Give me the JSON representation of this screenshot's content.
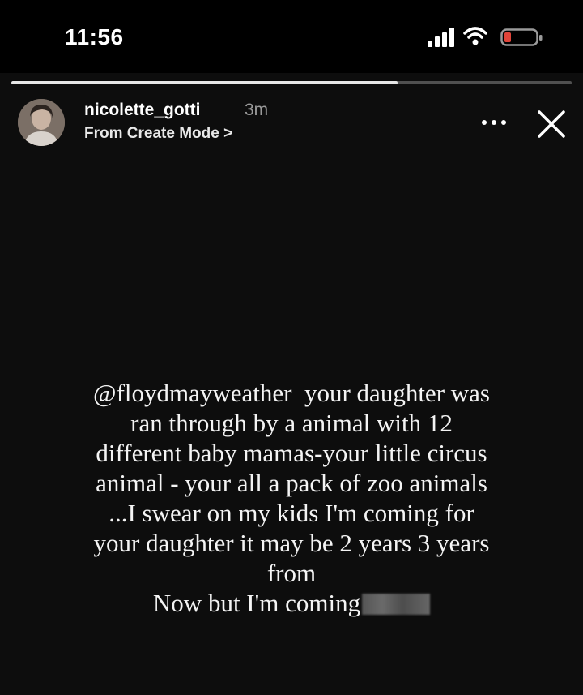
{
  "status_bar": {
    "time": "11:56",
    "icons": [
      "signal-icon",
      "wifi-icon",
      "battery-icon"
    ],
    "battery_color": "#e0453a"
  },
  "story": {
    "progress": 0.69,
    "username": "nicolette_gotti",
    "time_ago": "3m",
    "subtitle": "From Create Mode >",
    "actions": [
      "more-icon",
      "close-icon"
    ],
    "mention": "@floydmayweather",
    "lines": {
      "line1_rest": "your daughter was",
      "line2": "ran through by a animal with 12",
      "line3": "different baby mamas-your little circus",
      "line4": "animal - your all a pack of zoo animals",
      "line5": "...I swear on my kids I'm coming for",
      "line6": "your daughter it may be 2 years 3 years",
      "line7": "from",
      "line8": "Now but I'm coming"
    }
  }
}
